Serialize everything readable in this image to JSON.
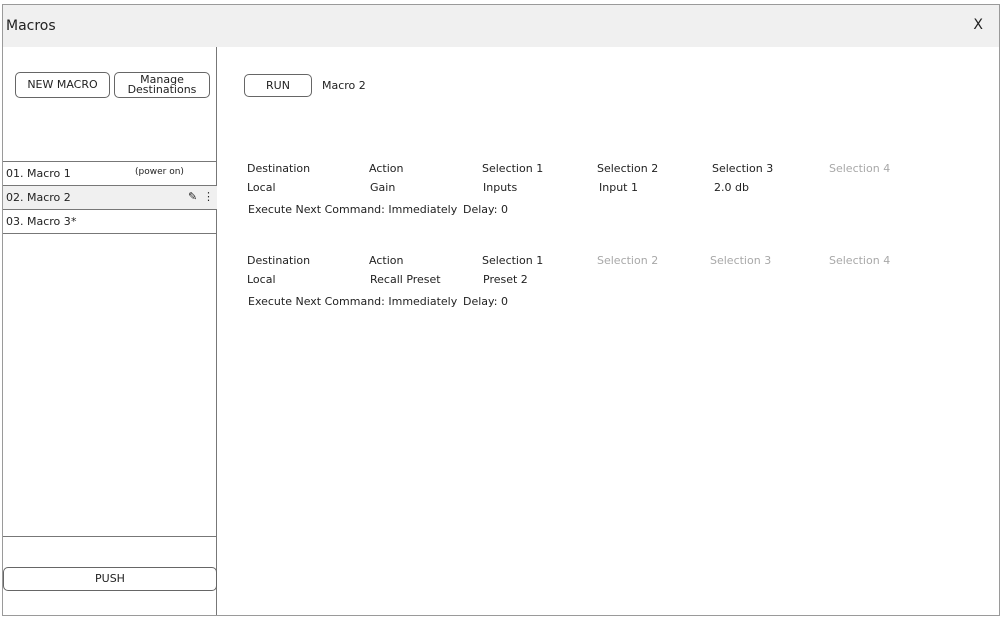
{
  "window": {
    "title": "Macros",
    "close_label": "X"
  },
  "sidebar": {
    "new_macro_label": "NEW MACRO",
    "manage_destinations_line1": "Manage",
    "manage_destinations_line2": "Destinations",
    "macros": [
      {
        "label": "01. Macro 1",
        "note": "(power on)"
      },
      {
        "label": "02. Macro 2",
        "selected": true
      },
      {
        "label": "03. Macro 3",
        "modified_marker": "*"
      }
    ],
    "push_label": "PUSH"
  },
  "main": {
    "run_label": "RUN",
    "macro_name": "Macro 2",
    "headers": [
      "Destination",
      "Action",
      "Selection 1",
      "Selection 2",
      "Selection 3",
      "Selection 4"
    ],
    "exec_label": "Execute Next Command:",
    "commands": [
      {
        "destination": "Local",
        "action": "Gain",
        "selections": [
          "Inputs",
          "Input 1",
          "2.0 db",
          ""
        ],
        "execute_next": "Immediately",
        "delay": "Delay: 0"
      },
      {
        "destination": "Local",
        "action": "Recall Preset",
        "selections": [
          "Preset 2",
          "",
          "",
          ""
        ],
        "execute_next": "Immediately",
        "delay": "Delay: 0"
      }
    ]
  },
  "colors": {
    "disabled_text": "#a8a8a8",
    "selected_row": "#f0f0f0",
    "titlebar": "#f0f0f0"
  }
}
